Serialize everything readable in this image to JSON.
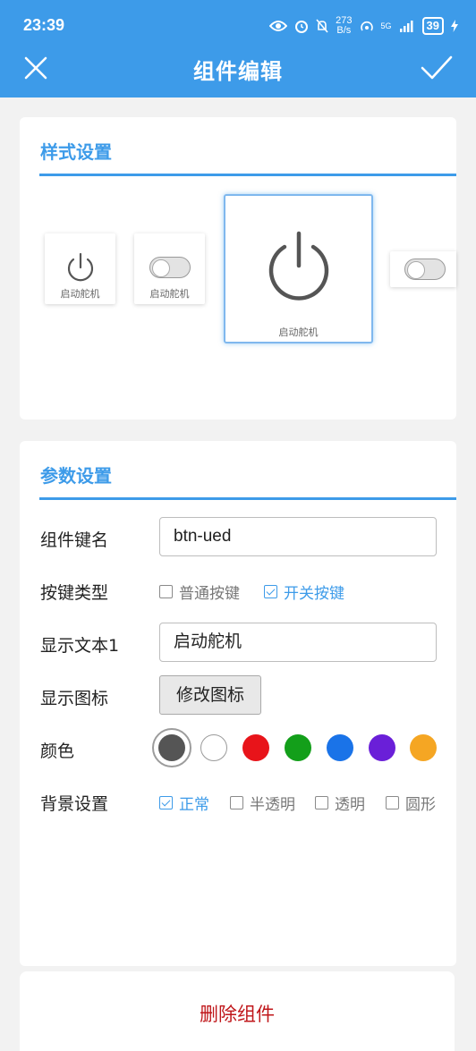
{
  "status_bar": {
    "time": "23:39",
    "net_speed_value": "273",
    "net_speed_unit": "B/s",
    "signal_label": "5G",
    "battery": "39"
  },
  "header": {
    "title": "组件编辑",
    "close_icon": "close-icon",
    "confirm_icon": "check-icon"
  },
  "style_section": {
    "title": "样式设置",
    "previews": [
      {
        "type": "power-icon",
        "label": "启动舵机"
      },
      {
        "type": "toggle-switch",
        "label": "启动舵机"
      },
      {
        "type": "power-icon",
        "label": "启动舵机",
        "selected": true
      },
      {
        "type": "toggle-switch",
        "label": ""
      }
    ]
  },
  "params_section": {
    "title": "参数设置",
    "key_name_label": "组件键名",
    "key_name_value": "btn-ued",
    "key_type_label": "按键类型",
    "key_type_options": [
      {
        "label": "普通按键",
        "checked": false
      },
      {
        "label": "开关按键",
        "checked": true
      }
    ],
    "display_text_label": "显示文本1",
    "display_text_value": "启动舵机",
    "display_icon_label": "显示图标",
    "modify_icon_button": "修改图标",
    "color_label": "颜色",
    "colors": [
      "#555555",
      "#ffffff",
      "#e8141a",
      "#139f1a",
      "#1a73e8",
      "#6a1fd8",
      "#f5a623"
    ],
    "selected_color": "#555555",
    "background_label": "背景设置",
    "background_options": [
      {
        "label": "正常",
        "checked": true
      },
      {
        "label": "半透明",
        "checked": false
      },
      {
        "label": "透明",
        "checked": false
      },
      {
        "label": "圆形",
        "checked": false
      }
    ]
  },
  "delete_button": "删除组件"
}
